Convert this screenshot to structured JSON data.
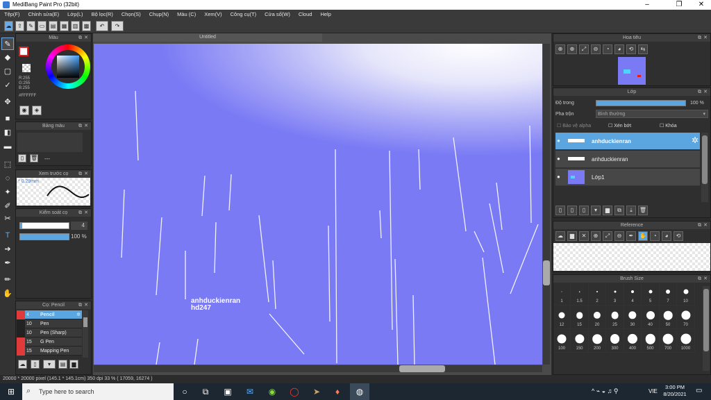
{
  "window": {
    "title": "MediBang Paint Pro (32bit)"
  },
  "menu": [
    "Tệp(F)",
    "Chỉnh sửa(E)",
    "Lớp(L)",
    "Bộ lọc(R)",
    "Chọn(S)",
    "Chụp(N)",
    "Màu (C)",
    "Xem(V)",
    "Công cụ(T)",
    "Cửa số(W)",
    "Cloud",
    "Help"
  ],
  "color_panel": {
    "title": "Màu",
    "rgb": [
      "R:255",
      "G:255",
      "B:255"
    ],
    "hex": "#FFFFFF"
  },
  "palette_panel": {
    "title": "Bảng màu",
    "empty": "---"
  },
  "brush_preview": {
    "title": "Xem trước cọ",
    "size": "* 0.29mm"
  },
  "brush_control": {
    "title": "Kiểm soát cọ",
    "size_value": "4",
    "opacity_value": "100 %"
  },
  "brush_panel": {
    "title": "Cọ: Pencil",
    "items": [
      {
        "size": "4",
        "name": "Pencil",
        "color": "#e03a3a"
      },
      {
        "size": "10",
        "name": "Pen",
        "color": "#222"
      },
      {
        "size": "10",
        "name": "Pen (Sharp)",
        "color": "#222"
      },
      {
        "size": "15",
        "name": "G Pen",
        "color": "#e03a3a"
      },
      {
        "size": "15",
        "name": "Mapping Pen",
        "color": "#e03a3a"
      }
    ]
  },
  "canvas": {
    "tab": "Untitled",
    "watermark_line1": "anhduckienran",
    "watermark_line2": "hd247"
  },
  "navigator": {
    "title": "Hoa tiêu"
  },
  "layer_panel": {
    "title": "Lớp",
    "opacity_label": "Độ trong",
    "opacity_value": "100 %",
    "blend_label": "Pha trộn",
    "blend_value": "Bình thường",
    "protect_alpha": "Bảo vệ alpha",
    "clipping": "Xén bớt",
    "lock": "Khóa",
    "layers": [
      {
        "name": "anhduckienran"
      },
      {
        "name": "anhduckienran"
      },
      {
        "name": "Lớp1"
      }
    ]
  },
  "reference": {
    "title": "Reference"
  },
  "brush_size": {
    "title": "Brush Size",
    "row1": [
      "1",
      "1.5",
      "2",
      "3",
      "4",
      "5",
      "7",
      "10"
    ],
    "row2": [
      "12",
      "15",
      "20",
      "25",
      "30",
      "40",
      "50",
      "70"
    ],
    "row3": [
      "100",
      "150",
      "200",
      "300",
      "400",
      "500",
      "700",
      "1000"
    ]
  },
  "status": "20000 * 20000 pixel  (145.1 * 145.1cm)  350 dpi  33 %  ( 17059, 16274 )",
  "taskbar": {
    "search_placeholder": "Type here to search",
    "lang": "VIE",
    "time": "3:00 PM",
    "date": "8/20/2021"
  }
}
